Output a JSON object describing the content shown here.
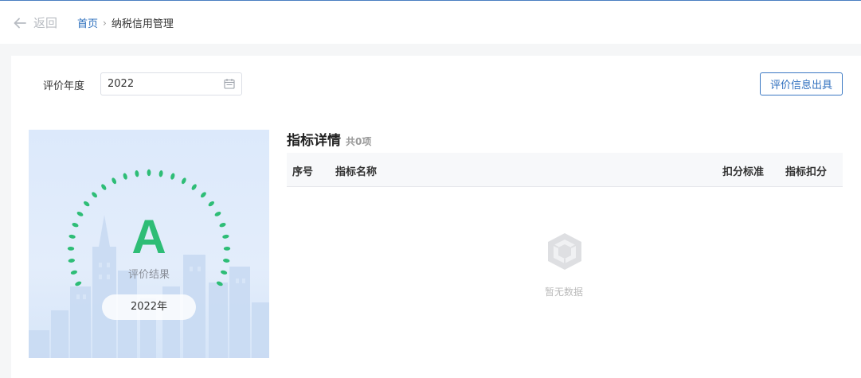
{
  "header": {
    "back_label": "返回",
    "breadcrumb": {
      "home": "首页",
      "separator": "›",
      "current": "纳税信用管理"
    }
  },
  "filter": {
    "year_label": "评价年度",
    "year_value": "2022",
    "calendar_icon": "calendar-icon"
  },
  "toolbar": {
    "export_label": "评价信息出具"
  },
  "result": {
    "grade": "A",
    "grade_caption": "评价结果",
    "year_pill": "2022年",
    "grade_color": "#2ebd76"
  },
  "details": {
    "title": "指标详情",
    "count": "共0项",
    "columns": [
      "序号",
      "指标名称",
      "扣分标准",
      "指标扣分"
    ],
    "rows": [],
    "empty_text": "暂无数据"
  },
  "colors": {
    "accent": "#2c6fbd",
    "success": "#2ebd76"
  }
}
